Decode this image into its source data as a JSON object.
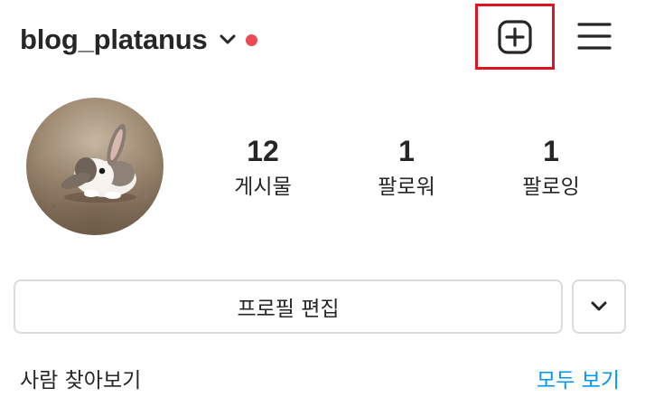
{
  "header": {
    "username": "blog_platanus",
    "has_notification": true,
    "notification_color": "#ed4956",
    "add_icon": "plus-square-icon",
    "menu_icon": "hamburger-menu-icon",
    "highlight_color": "#e0141e"
  },
  "profile": {
    "avatar_icon": "rabbit-profile-photo",
    "stats": [
      {
        "value": "12",
        "label": "게시물"
      },
      {
        "value": "1",
        "label": "팔로워"
      },
      {
        "value": "1",
        "label": "팔로잉"
      }
    ]
  },
  "actions": {
    "edit_profile_label": "프로필 편집",
    "expand_icon": "chevron-down-icon"
  },
  "discover": {
    "label": "사람 찾아보기",
    "see_all_label": "모두 보기",
    "link_color": "#0095f6"
  }
}
